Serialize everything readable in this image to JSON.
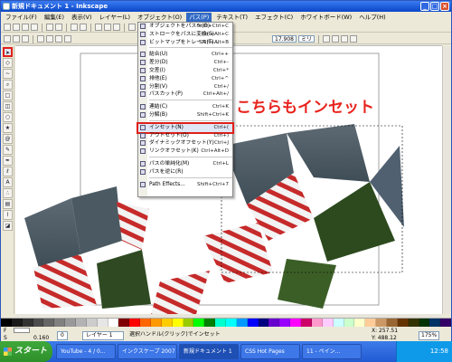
{
  "window": {
    "title": "新規ドキュメント 1 - Inkscape",
    "min": "_",
    "max": "□",
    "close": "×"
  },
  "menubar": [
    "ファイル(F)",
    "編集(E)",
    "表示(V)",
    "レイヤー(L)",
    "オブジェクト(O)",
    "パス(P)",
    "テキスト(T)",
    "エフェクト(C)",
    "ホワイトボード(W)",
    "ヘルプ(H)"
  ],
  "active_menu_index": 5,
  "toolbar2": {
    "w_field": "17.908",
    "h_field": "ミリ"
  },
  "path_menu": [
    {
      "label": "オブジェクトをパスへ(O)",
      "shortcut": "Shift+Ctrl+C"
    },
    {
      "label": "ストロークをパスに変換(S)",
      "shortcut": "Ctrl+Alt+C"
    },
    {
      "label": "ビットマップをトレース(T)...",
      "shortcut": "Shift+Alt+B"
    },
    {
      "sep": true
    },
    {
      "label": "結合(U)",
      "shortcut": "Ctrl++"
    },
    {
      "label": "差分(D)",
      "shortcut": "Ctrl+-"
    },
    {
      "label": "交差(I)",
      "shortcut": "Ctrl+*"
    },
    {
      "label": "排他(E)",
      "shortcut": "Ctrl+^"
    },
    {
      "label": "分割(V)",
      "shortcut": "Ctrl+/"
    },
    {
      "label": "パスカット(P)",
      "shortcut": "Ctrl+Alt+/"
    },
    {
      "sep": true
    },
    {
      "label": "連結(C)",
      "shortcut": "Ctrl+K"
    },
    {
      "label": "分解(B)",
      "shortcut": "Shift+Ctrl+K"
    },
    {
      "sep": true
    },
    {
      "label": "インセット(N)",
      "shortcut": "Ctrl+(",
      "highlight": true
    },
    {
      "label": "アウトセット(O)",
      "shortcut": "Ctrl+)"
    },
    {
      "label": "ダイナミックオフセット(Y)",
      "shortcut": "Ctrl+J"
    },
    {
      "label": "リンクオフセット(K)",
      "shortcut": "Ctrl+Alt+D"
    },
    {
      "sep": true
    },
    {
      "label": "パスの単純化(M)",
      "shortcut": "Ctrl+L"
    },
    {
      "label": "パスを逆に(R)",
      "shortcut": ""
    },
    {
      "sep": true
    },
    {
      "label": "Path Effects...",
      "shortcut": "Shift+Ctrl+7"
    }
  ],
  "annotation": "こちらもインセット",
  "status": {
    "fill_label": "F",
    "stroke_label": "S",
    "stroke_val": "0.160",
    "opacity": "0",
    "layer": "レイヤー 1",
    "message": "選択ハンドル(クリック)でインセット",
    "x": "X: 257.51",
    "y": "Y: 488.12",
    "zoom": "175%"
  },
  "taskbar": {
    "start": "スタート",
    "tasks": [
      "YouTube - 4 / 0...",
      "インクスケープ 2007",
      "新規ドキュメント 1",
      "CSS Hot Pages",
      "11 - ペイン..."
    ],
    "active_index": 2,
    "time": "12:58"
  },
  "palette_colors": [
    "#000000",
    "#1a1a1a",
    "#333333",
    "#4d4d4d",
    "#666666",
    "#808080",
    "#999999",
    "#b3b3b3",
    "#cccccc",
    "#e6e6e6",
    "#ffffff",
    "#800000",
    "#ff0000",
    "#ff6600",
    "#ff9900",
    "#ffcc00",
    "#ffff00",
    "#99cc00",
    "#00ff00",
    "#008000",
    "#00ffcc",
    "#00ffff",
    "#0099ff",
    "#0000ff",
    "#000080",
    "#6600cc",
    "#9900ff",
    "#ff00ff",
    "#cc0066",
    "#ff99cc",
    "#ffccff",
    "#ccffff",
    "#ccffcc",
    "#ffffcc",
    "#ffcc99",
    "#cc9966",
    "#996633",
    "#663300",
    "#333300",
    "#003300",
    "#003366",
    "#330066"
  ]
}
